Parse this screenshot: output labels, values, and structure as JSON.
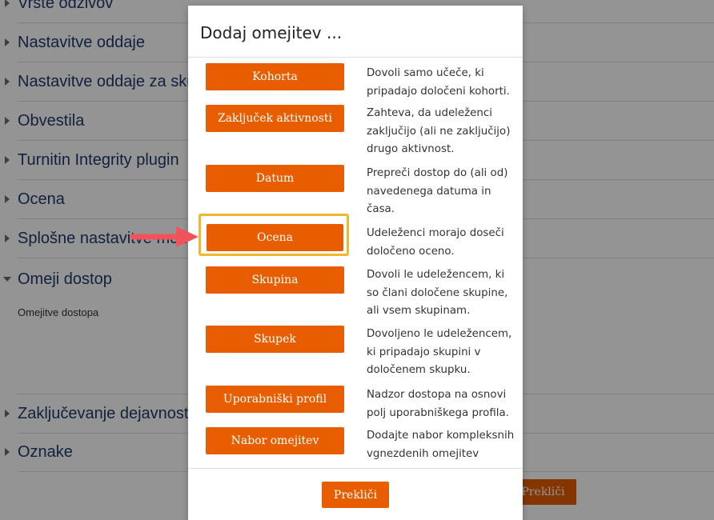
{
  "background": {
    "sections": [
      {
        "label": "Vrste odzivov"
      },
      {
        "label": "Nastavitve oddaje"
      },
      {
        "label": "Nastavitve oddaje za skupine"
      },
      {
        "label": "Obvestila"
      },
      {
        "label": "Turnitin Integrity plugin"
      },
      {
        "label": "Ocena"
      },
      {
        "label": "Splošne nastavitve modula"
      },
      {
        "label": "Omeji dostop"
      },
      {
        "label": "Zaključevanje dejavnosti"
      },
      {
        "label": "Oznake"
      }
    ],
    "restrictions_label": "Omejitve dostopa",
    "cancel_label": "Prekliči"
  },
  "modal": {
    "title": "Dodaj omejitev ...",
    "options": [
      {
        "label": "Kohorta",
        "description": "Dovoli samo učeče, ki pripadajo določeni kohorti."
      },
      {
        "label": "Zaključek aktivnosti",
        "description": "Zahteva, da udeleženci zaključijo (ali ne zaključijo) drugo aktivnost."
      },
      {
        "label": "Datum",
        "description": "Prepreči dostop do (ali od) navedenega datuma in časa."
      },
      {
        "label": "Ocena",
        "description": "Udeleženci morajo doseči določeno oceno."
      },
      {
        "label": "Skupina",
        "description": "Dovoli le udeležencem, ki so člani določene skupine, ali vsem skupinam."
      },
      {
        "label": "Skupek",
        "description": "Dovoljeno le udeležencem, ki pripadajo skupini v določenem skupku."
      },
      {
        "label": "Uporabniški profil",
        "description": "Nadzor dostopa na osnovi polj uporabniškega profila."
      },
      {
        "label": "Nabor omejitev",
        "description": "Dodajte nabor kompleksnih vgnezdenih omejitev"
      }
    ],
    "cancel_label": "Prekliči"
  },
  "colors": {
    "accent": "#e85d00",
    "highlight": "#f0b72f",
    "arrow": "#f0545a",
    "section_text": "#1f3a6b"
  }
}
